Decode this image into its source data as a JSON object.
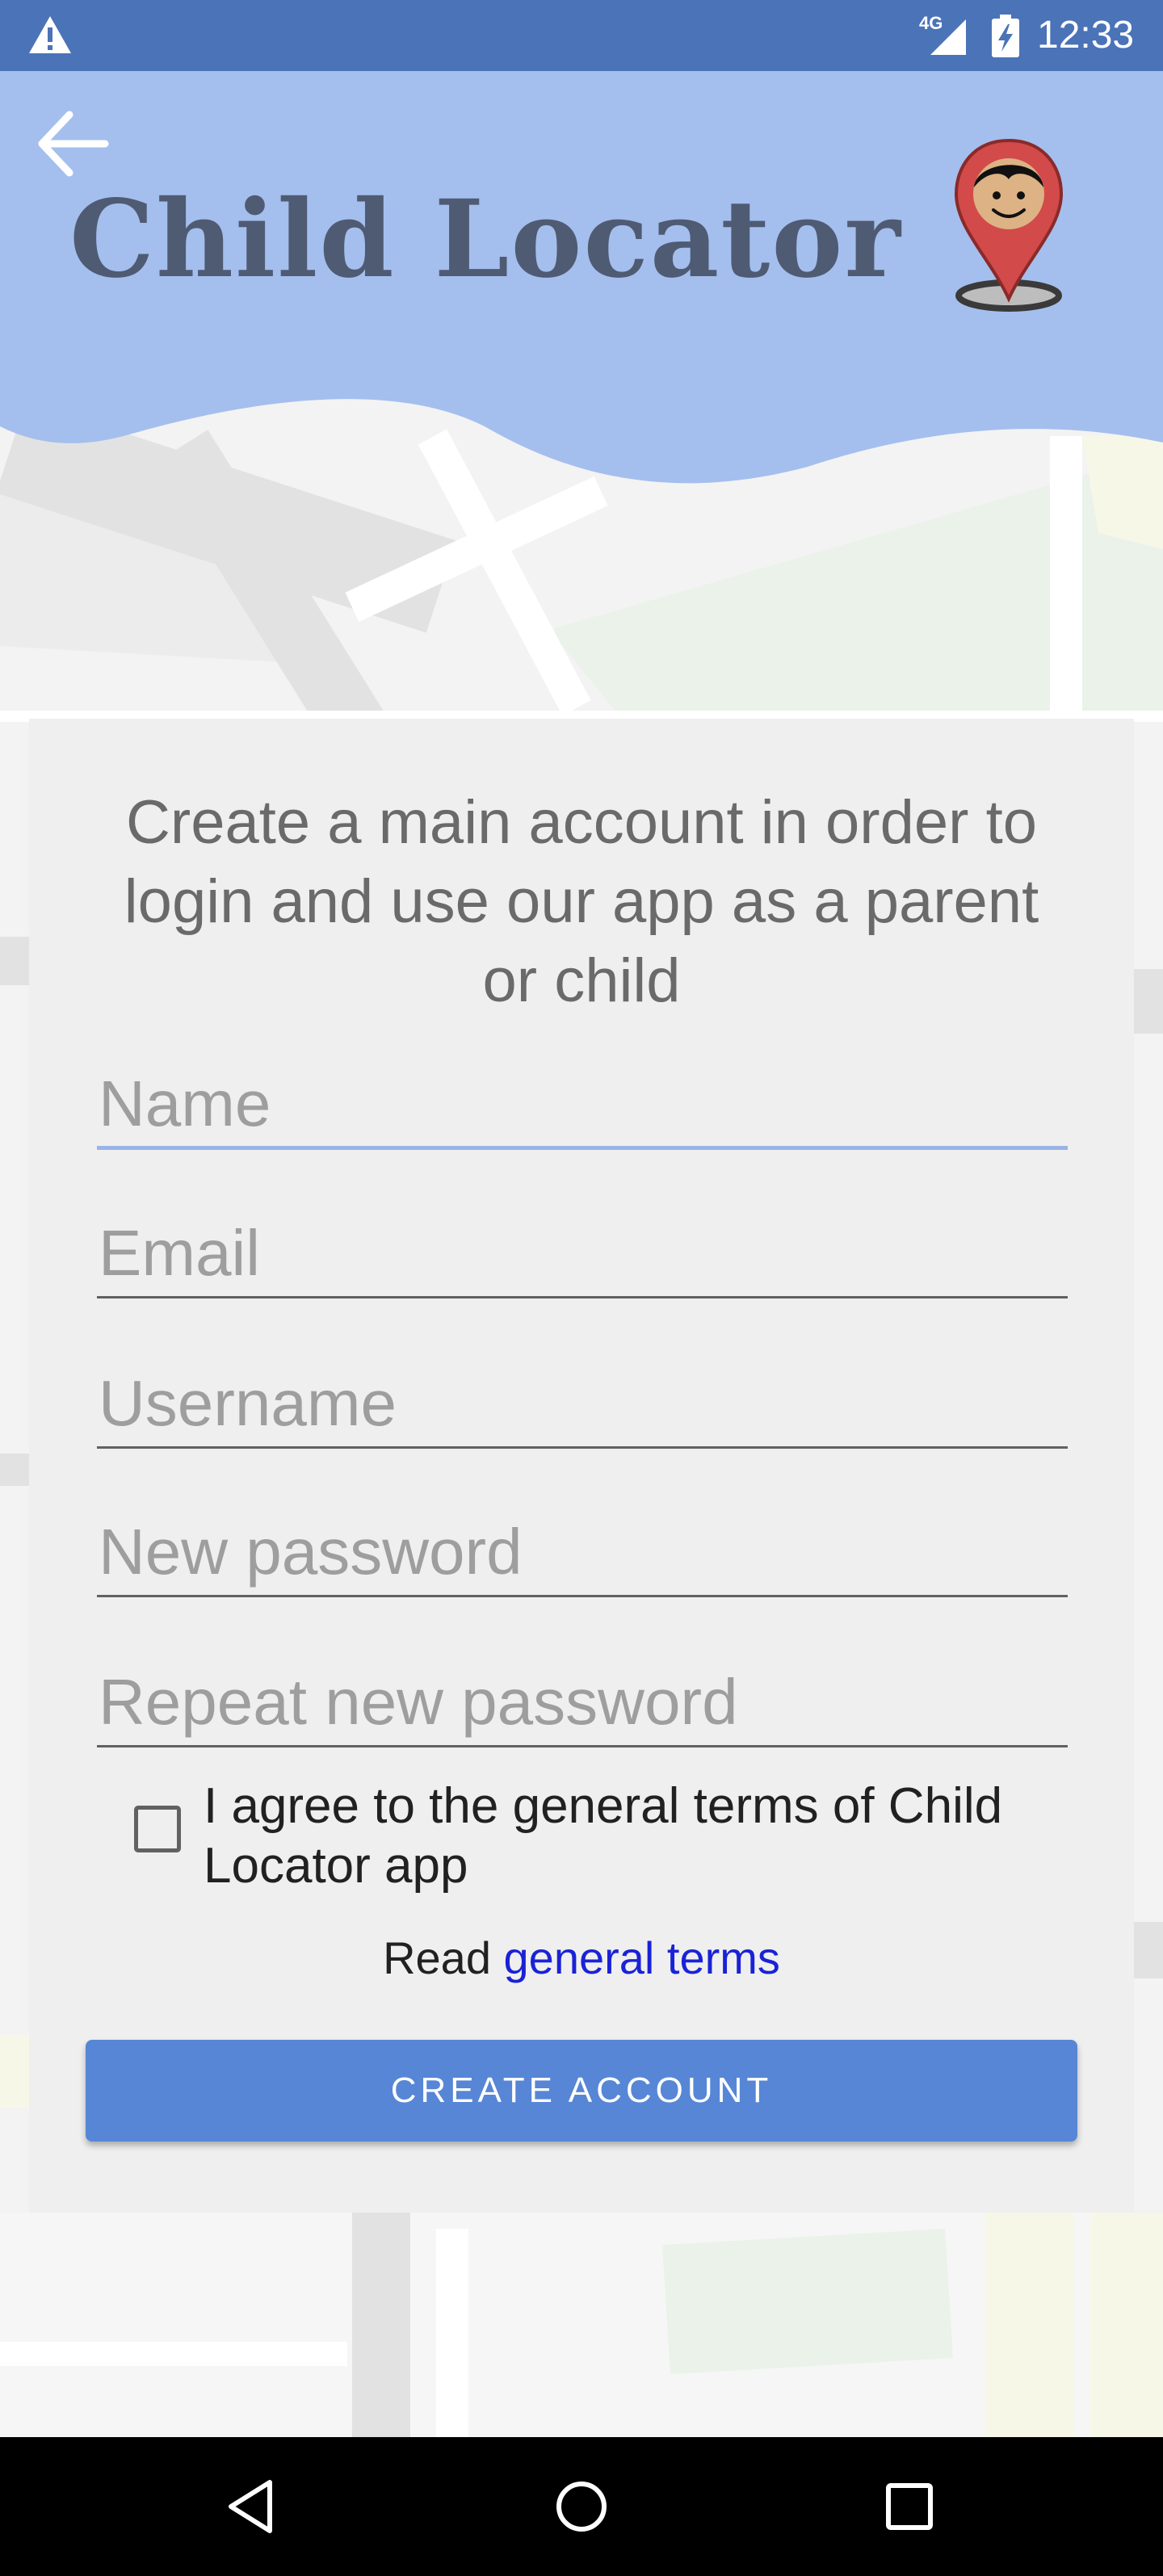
{
  "status_bar": {
    "network_label": "4G",
    "time": "12:33",
    "icons": [
      "warning-icon",
      "signal-icon",
      "battery-charging-icon"
    ]
  },
  "header": {
    "back_icon": "arrow-left-icon",
    "title": "Child Locator",
    "logo_icon": "child-location-pin-icon",
    "background_color": "#a4bfee",
    "title_color": "#4f5b73"
  },
  "form": {
    "intro": "Create a main account in order to login and use our app as a parent or child",
    "fields": {
      "name": {
        "placeholder": "Name",
        "value": ""
      },
      "email": {
        "placeholder": "Email",
        "value": ""
      },
      "username": {
        "placeholder": "Username",
        "value": ""
      },
      "new_password": {
        "placeholder": "New password",
        "value": ""
      },
      "repeat_password": {
        "placeholder": "Repeat new password",
        "value": ""
      }
    },
    "terms_checkbox": {
      "label": "I agree to the general terms of Child Locator app",
      "checked": false
    },
    "read_prefix": "Read",
    "terms_link": "general terms",
    "submit_label": "CREATE ACCOUNT",
    "accent_color": "#5786d6",
    "link_color": "#1a22d6"
  },
  "nav_bar": {
    "back_icon": "triangle-back-icon",
    "home_icon": "circle-home-icon",
    "recents_icon": "square-recents-icon"
  }
}
